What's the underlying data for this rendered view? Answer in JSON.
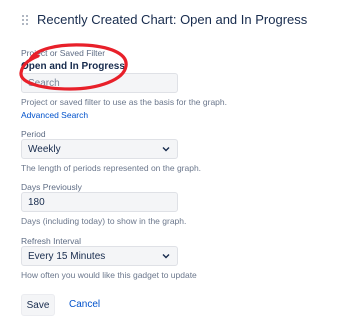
{
  "gadget": {
    "title": "Recently Created Chart: Open and In Progress"
  },
  "filter": {
    "label": "Project or Saved Filter",
    "selected": "Open and In Progress",
    "search_placeholder": "Search",
    "help": "Project or saved filter to use as the basis for the graph.",
    "advanced_search": "Advanced Search"
  },
  "period": {
    "label": "Period",
    "value": "Weekly",
    "help": "The length of periods represented on the graph."
  },
  "days_previously": {
    "label": "Days Previously",
    "value": "180",
    "help": "Days (including today) to show in the graph."
  },
  "refresh": {
    "label": "Refresh Interval",
    "value": "Every 15 Minutes",
    "help": "How often you would like this gadget to update"
  },
  "buttons": {
    "save": "Save",
    "cancel": "Cancel"
  },
  "colors": {
    "link": "#0052cc",
    "annotation": "#e8202a"
  }
}
